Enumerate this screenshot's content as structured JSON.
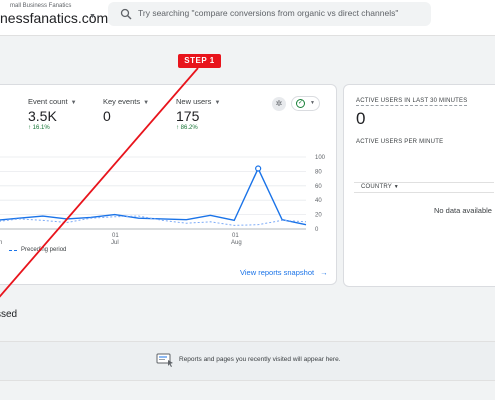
{
  "header": {
    "account_parent": "mall Business Fanatics",
    "account_name": "nessfanatics.com",
    "search_placeholder": "Try searching \"compare conversions from organic vs direct channels\""
  },
  "metrics": [
    {
      "label": "Event count",
      "value": "3.5K",
      "change": "↑ 16.1%"
    },
    {
      "label": "Key events",
      "value": "0",
      "change": ""
    },
    {
      "label": "New users",
      "value": "175",
      "change": "↑ 86.2%"
    }
  ],
  "chart_data": {
    "type": "line",
    "x_tick_labels": [
      {
        "text": "01",
        "sub": "Jul"
      },
      {
        "text": "01",
        "sub": "Aug"
      }
    ],
    "y_ticks": [
      0,
      20,
      40,
      60,
      80,
      100
    ],
    "ylim": [
      0,
      100
    ],
    "series": [
      {
        "values": [
          12,
          15,
          18,
          14,
          16,
          20,
          15,
          14,
          13,
          19,
          12,
          84,
          13,
          6
        ]
      },
      {
        "name": "Preceding period",
        "values": [
          10,
          14,
          12,
          9,
          15,
          17,
          18,
          12,
          8,
          10,
          5,
          6,
          12,
          10
        ],
        "dashed": true
      }
    ],
    "first_tick_partial": "n",
    "colors": {
      "current": "#1a73e8",
      "preceding": "#1a73e8"
    }
  },
  "legend": {
    "preceding_label": "Preceding period"
  },
  "links": {
    "snapshot": "View reports snapshot",
    "snapshot_arrow": "→"
  },
  "realtime": {
    "title": "ACTIVE USERS IN LAST 30 MINUTES",
    "value": "0",
    "per_minute": "ACTIVE USERS PER MINUTE",
    "country_col": "COUNTRY",
    "no_data": "No data available"
  },
  "recent": {
    "section_title": "ssed",
    "message": "Reports and pages you recently visited will appear here."
  },
  "annotation": {
    "step_label": "STEP 1",
    "color": "#e8141c"
  }
}
